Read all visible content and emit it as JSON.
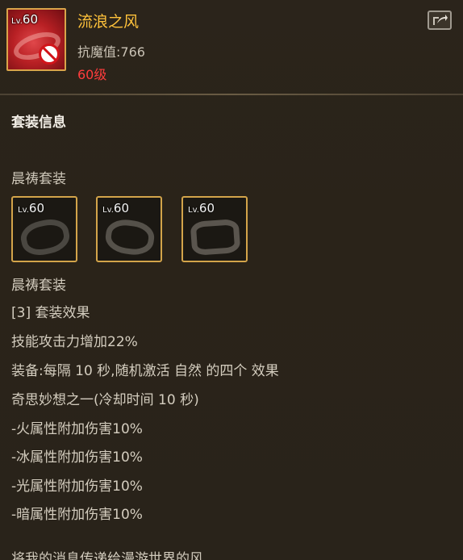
{
  "item": {
    "level_prefix": "Lv.",
    "level": "60",
    "name": "流浪之风",
    "stat": "抗魔值:766",
    "required_level": "60级",
    "icon": "red-belt-icon",
    "forbid_icon": "forbidden-icon",
    "share_icon": "share-icon"
  },
  "section_title": "套装信息",
  "set": {
    "name": "晨祷套装",
    "pieces": [
      {
        "level_prefix": "Lv.",
        "level": "60",
        "icon": "dark-armor-piece-icon"
      },
      {
        "level_prefix": "Lv.",
        "level": "60",
        "icon": "dark-belt-icon"
      },
      {
        "level_prefix": "Lv.",
        "level": "60",
        "icon": "dark-bracer-icon"
      }
    ],
    "name_repeat": "晨祷套装",
    "effect_header": "[3] 套装效果",
    "effects": [
      "技能攻击力增加22%",
      "装备:每隔 10 秒,随机激活 自然 的四个 效果",
      "奇思妙想之一(冷却时间 10 秒)",
      "-火属性附加伤害10%",
      "-冰属性附加伤害10%",
      "-光属性附加伤害10%",
      "-暗属性附加伤害10%"
    ]
  },
  "flavor_text": "将我的消息传递给漫游世界的风。",
  "colors": {
    "item_name": "#ffc23b",
    "required_level": "#ff3c3c",
    "slot_border": "#d3a44a",
    "background": "#2a2319"
  }
}
